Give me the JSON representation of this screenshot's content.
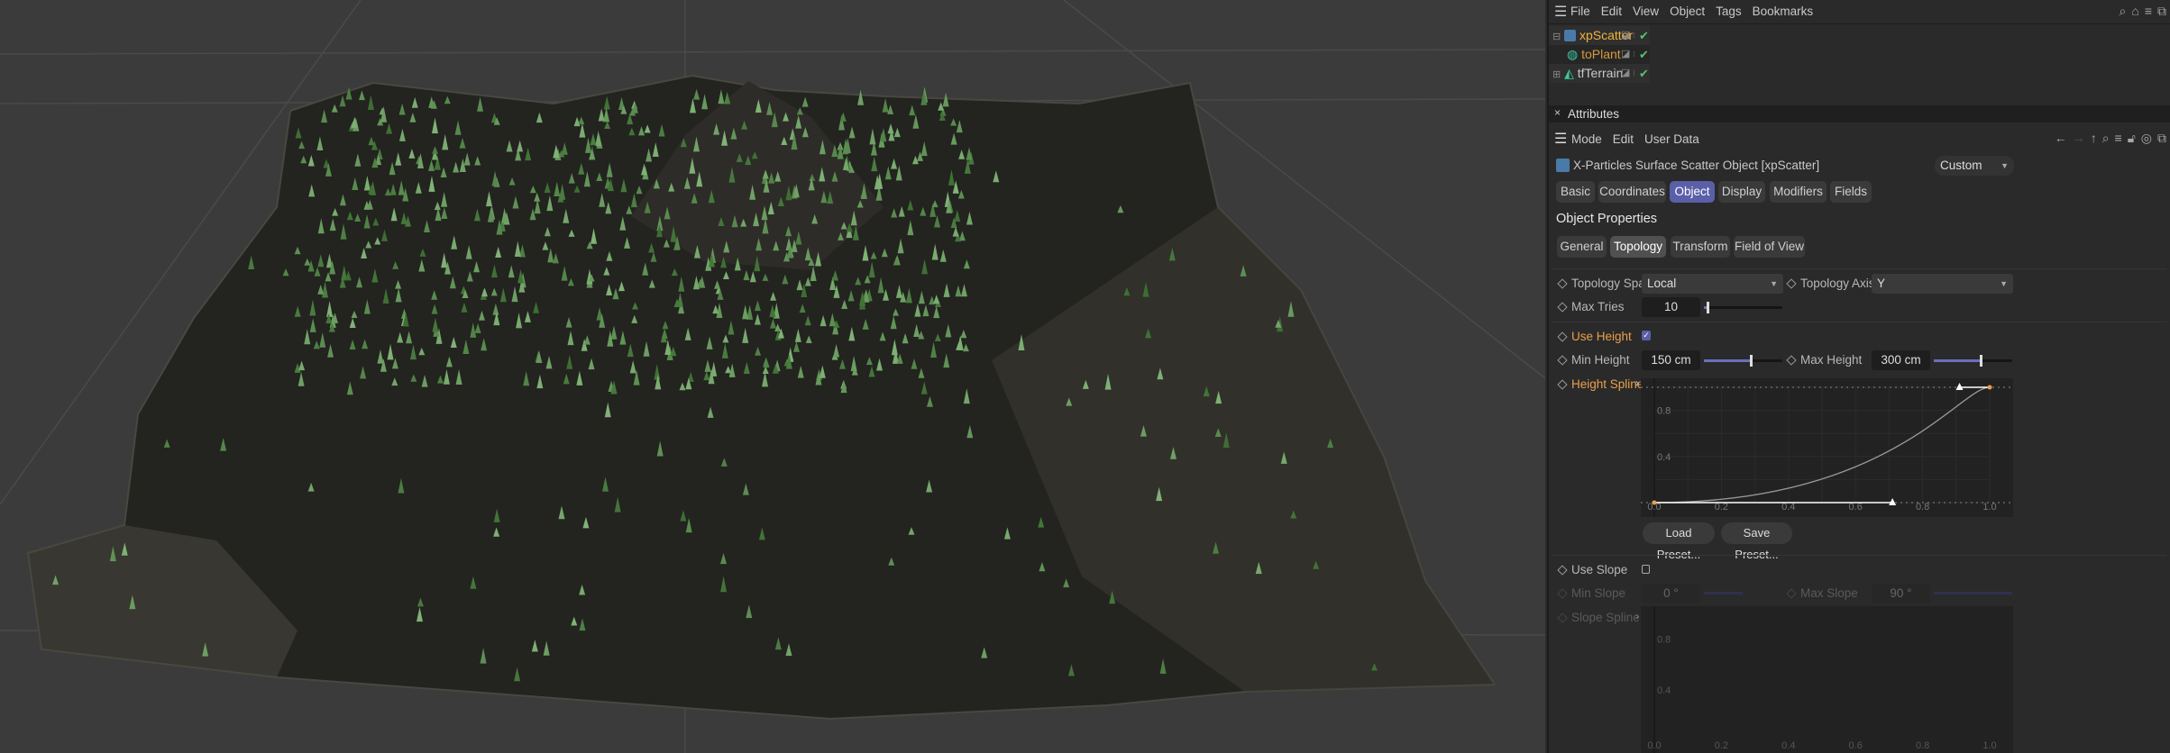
{
  "object_manager": {
    "menu": [
      "File",
      "Edit",
      "View",
      "Object",
      "Tags",
      "Bookmarks"
    ],
    "toolbar_icons": [
      "search-icon",
      "home-icon",
      "filter-icon",
      "new-window-icon"
    ],
    "objects": [
      {
        "name": "xpScatter",
        "icon": "scatter-icon",
        "color": "#f0b43c",
        "expanded": true,
        "enabled": true
      },
      {
        "name": "toPlant",
        "icon": "plant-icon",
        "color": "#d89a3a",
        "child": true,
        "enabled": true
      },
      {
        "name": "tfTerrain",
        "icon": "terrain-icon",
        "color": "#c9c9c9",
        "expanded": false,
        "enabled": true
      }
    ]
  },
  "attributes": {
    "title": "Attributes",
    "menu": [
      "Mode",
      "Edit",
      "User Data"
    ],
    "toolbar_icons": [
      "back-icon",
      "forward-icon",
      "up-icon",
      "search-icon",
      "filter-icon",
      "lock-icon",
      "target-icon",
      "new-window-icon"
    ],
    "object_title": "X-Particles Surface Scatter Object [xpScatter]",
    "mode_select": "Custom",
    "tabs": [
      "Basic",
      "Coordinates",
      "Object",
      "Display",
      "Modifiers",
      "Fields"
    ],
    "active_tab": "Object",
    "section_title": "Object Properties",
    "subtabs": [
      "General",
      "Topology",
      "Transform",
      "Field of View"
    ],
    "active_subtab": "Topology",
    "topology_space": {
      "label": "Topology Space",
      "value": "Local"
    },
    "topology_axis": {
      "label": "Topology Axis",
      "value": "Y"
    },
    "max_tries": {
      "label": "Max Tries",
      "value": "10",
      "slider": 0.05
    },
    "use_height": {
      "label": "Use Height",
      "checked": true
    },
    "min_height": {
      "label": "Min Height",
      "value": "150 cm",
      "slider": 0.6
    },
    "max_height": {
      "label": "Max Height",
      "value": "300 cm",
      "slider": 0.6
    },
    "height_spline": {
      "label": "Height Spline",
      "y_ticks": [
        "0.8",
        "0.4"
      ],
      "x_ticks": [
        "0.0",
        "0.2",
        "0.4",
        "0.6",
        "0.8",
        "1.0"
      ],
      "knots": [
        {
          "x": 0,
          "y": 0,
          "handle_out": {
            "x": 0.71,
            "y": 0
          }
        },
        {
          "x": 1,
          "y": 1,
          "handle_in": {
            "x": 0.91,
            "y": 1
          }
        }
      ]
    },
    "load_preset": "Load Preset...",
    "save_preset": "Save Preset...",
    "use_slope": {
      "label": "Use Slope",
      "checked": false
    },
    "min_slope": {
      "label": "Min Slope",
      "value": "0 °"
    },
    "max_slope": {
      "label": "Max Slope",
      "value": "90 °"
    },
    "slope_spline": {
      "label": "Slope Spline",
      "y_ticks": [
        "0.8",
        "0.4"
      ],
      "x_ticks": [
        "0.0",
        "0.2",
        "0.4",
        "0.6",
        "0.8",
        "1.0"
      ]
    }
  },
  "colors": {
    "accent": "#5a5fa8",
    "highlight_label": "#e9a04c",
    "enabled_check": "#58c46a"
  }
}
